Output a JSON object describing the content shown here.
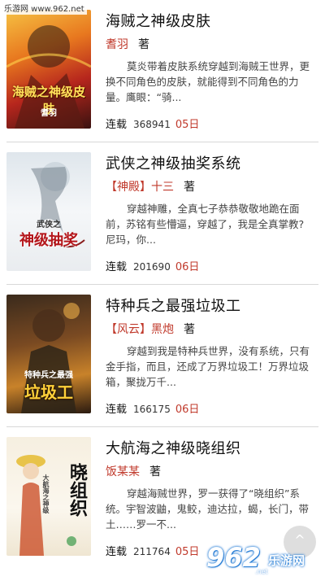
{
  "watermark": "乐游网 www.962.net",
  "books": [
    {
      "title": "海贼之神级皮肤",
      "author_tag": "",
      "author": "耆羽",
      "role": "著",
      "description": "莫炎带着皮肤系统穿越到海贼王世界，更换不同角色的皮肤，就能得到不同角色的力量。鹰眼：“骑...",
      "status": "连载",
      "count": "368941",
      "date": "05日",
      "cover_text": "海贼之神级皮肤",
      "cover_sub": "耆羽"
    },
    {
      "title": "武侠之神级抽奖系统",
      "author_tag": "【神殿】",
      "author": "十三",
      "role": "著",
      "description": "穿越神雕，全真七子恭恭敬敬地跪在面前，苏铭有些懵逼，穿越了，我是全真掌教?尼玛，你...",
      "status": "连载",
      "count": "201690",
      "date": "06日",
      "cover_text": "神级抽奖",
      "cover_sub": "武侠之"
    },
    {
      "title": "特种兵之最强垃圾工",
      "author_tag": "【风云】",
      "author": "黑炮",
      "role": "著",
      "description": "穿越到我是特种兵世界，没有系统，只有金手指，而且，还成了万界垃圾工！万界垃圾箱，聚拢万千...",
      "status": "连载",
      "count": "166175",
      "date": "06日",
      "cover_text": "垃圾工",
      "cover_sub": "特种兵之最强"
    },
    {
      "title": "大航海之神级晓组织",
      "author_tag": "",
      "author": "饭某某",
      "role": "著",
      "description": "穿越海贼世界，罗一获得了“晓组织”系统。宇智波鼬，鬼鲛，迪达拉，蝎，长门，带土……罗一不...",
      "status": "连载",
      "count": "211764",
      "date": "05日",
      "cover_text": "晓组织",
      "cover_sub": "大航海之神级"
    }
  ],
  "scroll_top_label": "^",
  "logo": {
    "number": "962",
    "brand": "乐游网",
    "sub": ".net"
  },
  "colors": {
    "accent": "#c0392b",
    "divider": "#d8d8d8"
  }
}
